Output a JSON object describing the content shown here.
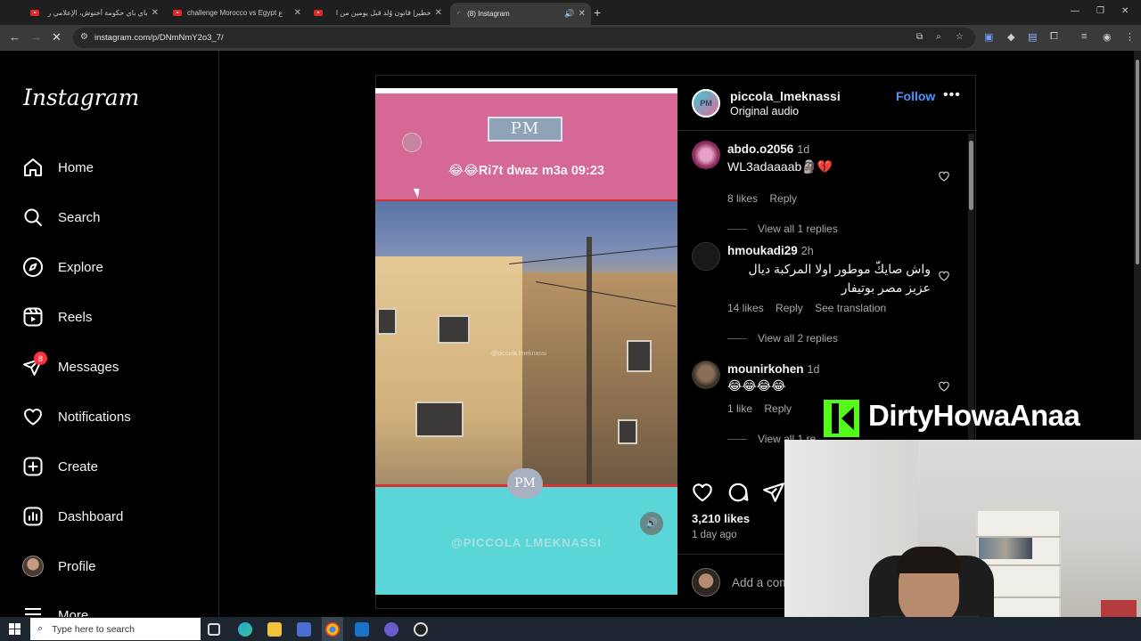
{
  "browser": {
    "tabs": [
      {
        "title": "باي باي حكومة أخنوش، الإعلامي ر"
      },
      {
        "title": "challenge Morocco vs Egypt ع"
      },
      {
        "title": "خطير| قانون وُلد قبل يومين من ا"
      },
      {
        "title": "(8) Instagram"
      }
    ],
    "url": "instagram.com/p/DNmNmY2o3_7/"
  },
  "sidebar": {
    "logo": "Instagram",
    "items": [
      {
        "label": "Home",
        "icon": "home-icon"
      },
      {
        "label": "Search",
        "icon": "search-icon"
      },
      {
        "label": "Explore",
        "icon": "compass-icon"
      },
      {
        "label": "Reels",
        "icon": "reels-icon"
      },
      {
        "label": "Messages",
        "icon": "paper-plane-icon",
        "badge": "8"
      },
      {
        "label": "Notifications",
        "icon": "heart-icon"
      },
      {
        "label": "Create",
        "icon": "plus-square-icon"
      },
      {
        "label": "Dashboard",
        "icon": "chart-icon"
      },
      {
        "label": "Profile",
        "icon": "avatar"
      },
      {
        "label": "More",
        "icon": "menu-icon"
      }
    ]
  },
  "video": {
    "pm_logo": "PM",
    "caption": "😂😂Ri7t dwaz m3a 09:23",
    "watermark": "@piccola lmeknassi",
    "pm_circle": "PM",
    "handle": "@PICCOLA LMEKNASSI"
  },
  "post": {
    "username": "piccola_lmeknassi",
    "audio": "Original audio",
    "follow": "Follow",
    "avatar_text": "PM",
    "likes": "3,210 likes",
    "time_ago": "1 day ago",
    "add_comment": "Add a comment…"
  },
  "comments": [
    {
      "user": "abdo.o2056",
      "time": "1d",
      "text": "WL3adaaaab🗿💔",
      "likes": "8 likes",
      "reply": "Reply",
      "view_replies": "View all 1 replies"
    },
    {
      "user": "hmoukadi29",
      "time": "2h",
      "text": "واش صايكّ موطور اولا المركبة ديال عزيز مصر بوتيفار",
      "likes": "14 likes",
      "reply": "Reply",
      "translate": "See translation",
      "view_replies": "View all 2 replies"
    },
    {
      "user": "mounirkohen",
      "time": "1d",
      "text": "😂😂😂😂",
      "likes": "1 like",
      "reply": "Reply",
      "view_replies": "View all 1 re"
    }
  ],
  "overlay": {
    "channel": "DirtyHowaAnaa"
  },
  "taskbar": {
    "search_placeholder": "Type here to search"
  },
  "colors": {
    "follow": "#4a96ff",
    "badge": "#ff3040",
    "kick_green": "#53fc18"
  }
}
